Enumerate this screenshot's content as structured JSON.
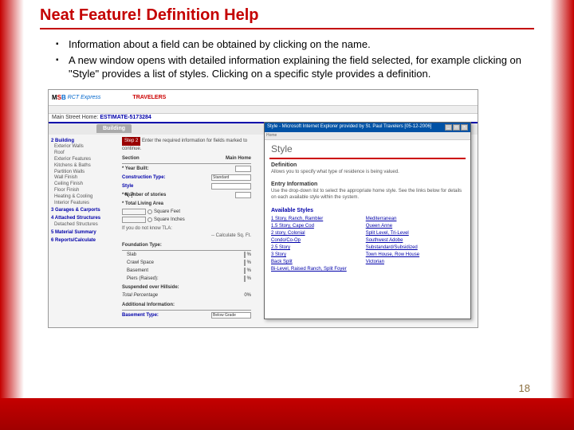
{
  "title": "Neat Feature!  Definition Help",
  "bullets": [
    "Information about a field can be obtained by clicking on the name.",
    "A new window opens with detailed information explaining the field selected, for example clicking on \"Style\" provides a list of styles.  Clicking on a specific style provides a definition."
  ],
  "app": {
    "logo_m": "M",
    "logo_s": "S",
    "logo_b": "B",
    "logo_rct": "RCT Express",
    "provider": "TRAVELERS",
    "main_street_label": "Main Street Home:",
    "estimate_id": "ESTIMATE-5173284",
    "tab_building": "Building"
  },
  "nav": {
    "g1": "2 Building",
    "items1": [
      "Exterior Walls",
      "Roof",
      "Exterior Features",
      "Kitchens & Baths",
      "Partition Walls",
      "Wall Finish",
      "Ceiling Finish",
      "Floor Finish",
      "Heating & Cooling",
      "Interior Features"
    ],
    "g2": "3 Garages & Carports",
    "g3": "4 Attached Structures",
    "g4": "Detached Structures",
    "g5": "5 Material Summary",
    "g6": "6 Reports/Calculate"
  },
  "form": {
    "step": "Step 2",
    "step_text": "Enter the required information for fields marked to continue.",
    "section": "Section",
    "main_home": "Main Home",
    "year_built": "* Year Built:",
    "construction_type": "Construction Type:",
    "construction_val": "Standard",
    "style": "Style",
    "number_stories": "* Number of stories",
    "total_living": "* Total Living Area",
    "sqft_radio1": "Square Feet",
    "sqft_radio2": "Square Inches",
    "calc_tla": "If you do not know TLA:",
    "calc_btn": "-- Calculate Sq. Ft.",
    "foundation_type": "Foundation Type:",
    "slab": "Slab",
    "crawl": "Crawl Space",
    "basement": "Basement",
    "piers": "Piers (Raised):",
    "suspended": "Suspended over Hillside:",
    "total_pct": "Total Percentage",
    "total_pct_val": "0%",
    "additional": "Additional Information:",
    "basement_type": "Basement Type:",
    "below_grade": "Below Grade"
  },
  "popup": {
    "window_title": "Style - Microsoft Internet Explorer provided by St. Paul Travelers [05-12-2006]",
    "addr": "Home",
    "heading": "Style",
    "definition_title": "Definition",
    "definition_text": "Allows you to specify what type of residence is being valued.",
    "entry_title": "Entry Information",
    "entry_text": "Use the drop-down list to select the appropriate home style. See the links below for details on each available style within the system.",
    "available_title": "Available Styles",
    "col1": [
      "1 Story, Ranch, Rambler",
      "1.5 Story, Cape Cod",
      "2 story, Colonial",
      "Condo/Co-Op",
      "2.5 Story",
      "3 Story",
      "Back Split",
      "Bi-Level, Raised Ranch, Split Foyer"
    ],
    "col2": [
      "Mediterranean",
      "Queen Anne",
      "Split Level, Tri-Level",
      "Southwest Adobe",
      "Substandard/Subsidized",
      "Town House, Row House",
      "Victorian"
    ]
  },
  "page_number": "18"
}
